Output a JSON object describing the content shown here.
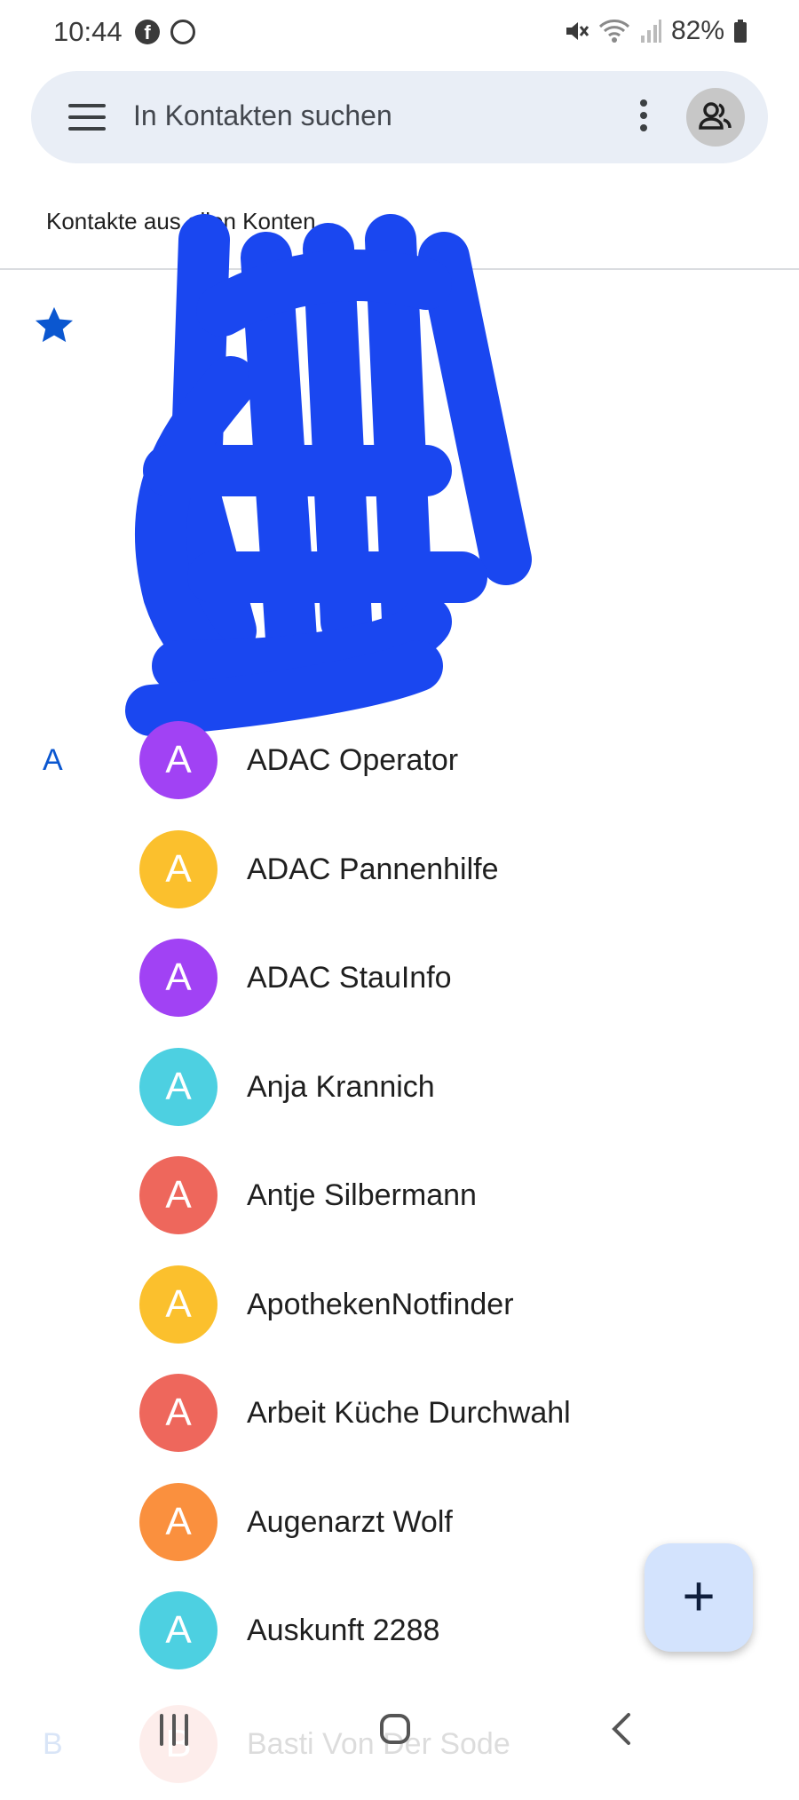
{
  "status_bar": {
    "time": "10:44",
    "battery": "82%",
    "app_icons": [
      "facebook-icon",
      "whatsapp-icon"
    ],
    "right_icons": [
      "mute-icon",
      "wifi-icon",
      "signal-icon",
      "battery-icon"
    ]
  },
  "search": {
    "placeholder": "In Kontakten suchen",
    "icons": [
      "menu-icon",
      "more-vert-icon",
      "account-switcher-icon"
    ]
  },
  "accounts_filter": {
    "label": "Kontakte aus allen Konten"
  },
  "favorites": {
    "icon": "star-icon",
    "color": "#0b57d0",
    "obscured": true
  },
  "sections": [
    {
      "letter": "A",
      "contacts": [
        {
          "initial": "A",
          "name": "ADAC Operator",
          "color": "#a142f4"
        },
        {
          "initial": "A",
          "name": "ADAC Pannenhilfe",
          "color": "#fbc02d"
        },
        {
          "initial": "A",
          "name": "ADAC StauInfo",
          "color": "#a142f4"
        },
        {
          "initial": "A",
          "name": "Anja Krannich",
          "color": "#4dd0e1"
        },
        {
          "initial": "A",
          "name": "Antje Silbermann",
          "color": "#ee675c"
        },
        {
          "initial": "A",
          "name": "ApothekenNotfinder",
          "color": "#fbc02d"
        },
        {
          "initial": "A",
          "name": "Arbeit Küche Durchwahl",
          "color": "#ee675c"
        },
        {
          "initial": "A",
          "name": "Augenarzt Wolf",
          "color": "#fa903e"
        },
        {
          "initial": "A",
          "name": "Auskunft 2288",
          "color": "#4dd0e1"
        }
      ]
    },
    {
      "letter": "B",
      "contacts": [
        {
          "initial": "B",
          "name": "Basti Von Der Sode",
          "color": "#f28b82"
        }
      ]
    }
  ],
  "fab": {
    "label": "+",
    "icon": "add-icon"
  },
  "nav_bar": {
    "icons": [
      "recents-icon",
      "home-icon",
      "back-icon"
    ]
  }
}
